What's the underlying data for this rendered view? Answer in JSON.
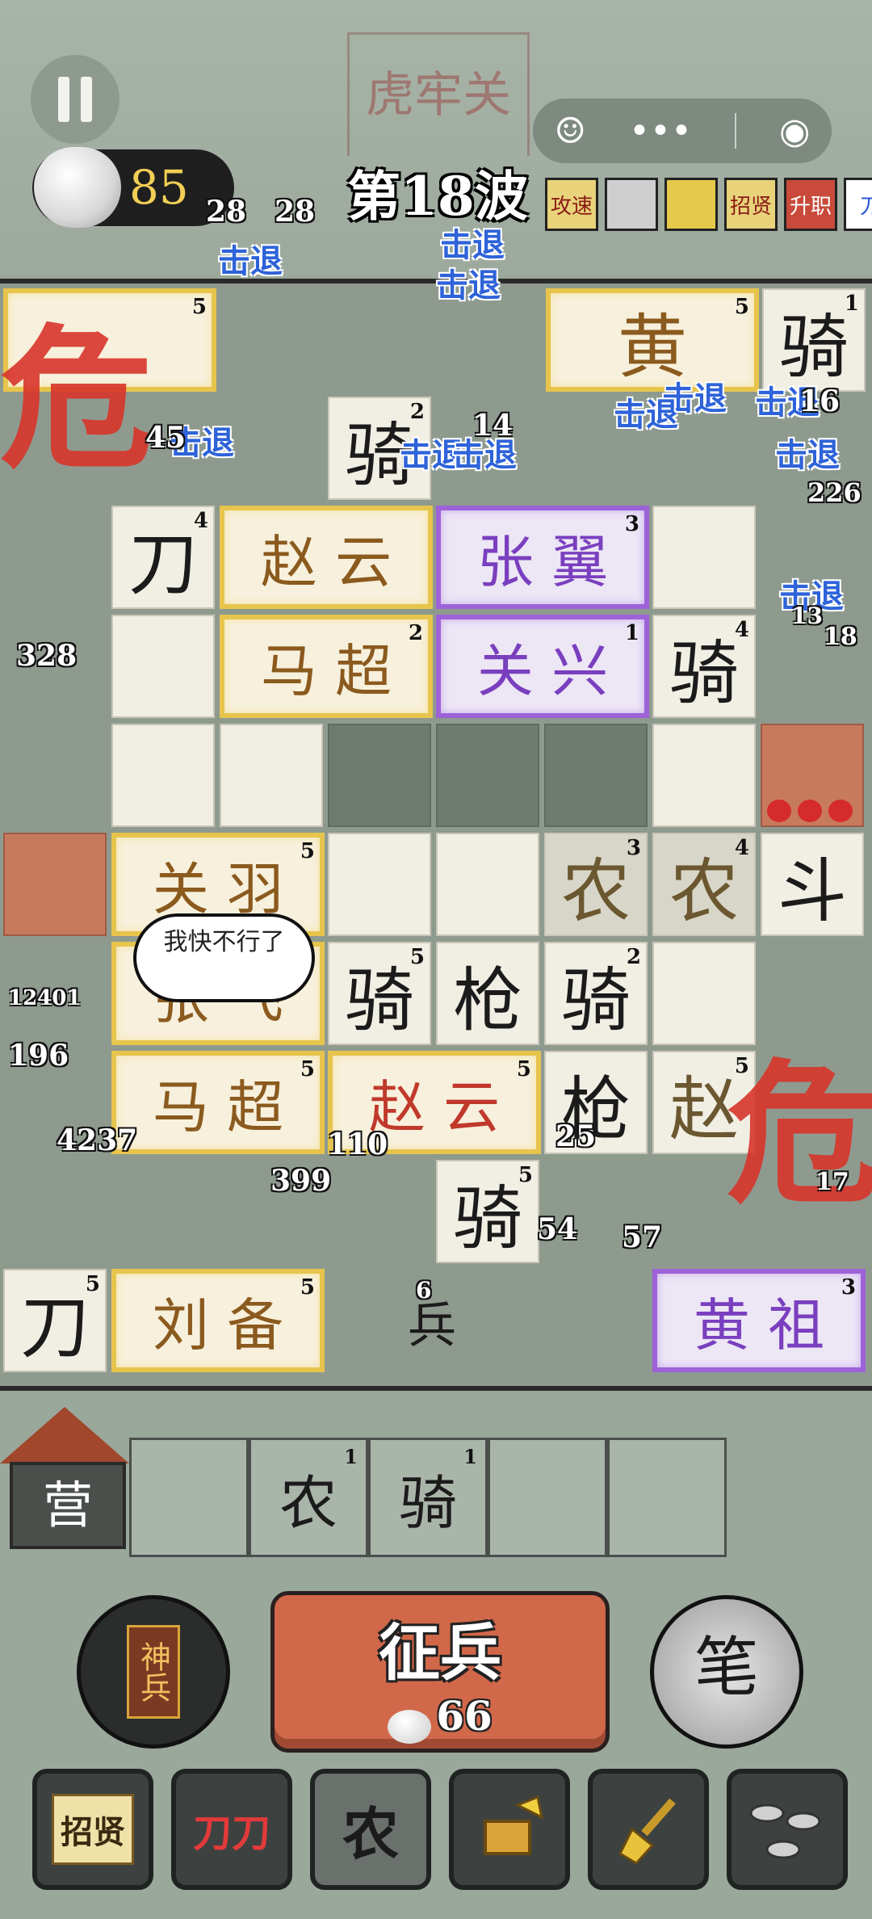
{
  "hud": {
    "resource_count": "85",
    "wave": "第18波",
    "fort_sign": "虎牢关",
    "capsule_more": "•••",
    "capsule_close": "◉",
    "buffs": [
      "攻速",
      "",
      "",
      "招贤",
      "升职",
      "刀"
    ]
  },
  "board": {
    "cells": [
      {
        "glyph": "",
        "level": "5",
        "style": "gold"
      },
      {
        "glyph": "黄",
        "level": "5",
        "style": "gold"
      },
      {
        "glyph": "骑",
        "level": "1",
        "style": "plain"
      },
      {
        "glyph": "骑",
        "level": "2",
        "style": "plain"
      },
      {
        "glyph": "刀",
        "level": "4",
        "style": "plain"
      },
      {
        "glyph": "赵 云",
        "level": "",
        "style": "gold"
      },
      {
        "glyph": "张 翼",
        "level": "3",
        "style": "purple"
      },
      {
        "glyph": "马 超",
        "level": "2",
        "style": "gold"
      },
      {
        "glyph": "关 兴",
        "level": "1",
        "style": "purple"
      },
      {
        "glyph": "骑",
        "level": "4",
        "style": "plain"
      },
      {
        "glyph": "关 羽",
        "level": "5",
        "style": "gold"
      },
      {
        "glyph": "农",
        "level": "3",
        "style": "plain"
      },
      {
        "glyph": "农",
        "level": "4",
        "style": "plain"
      },
      {
        "glyph": "斗",
        "level": "",
        "style": "plain"
      },
      {
        "glyph": "张 飞",
        "level": "5",
        "style": "gold"
      },
      {
        "glyph": "骑",
        "level": "5",
        "style": "plain"
      },
      {
        "glyph": "枪",
        "level": "",
        "style": "plain"
      },
      {
        "glyph": "骑",
        "level": "2",
        "style": "plain"
      },
      {
        "glyph": "马 超",
        "level": "5",
        "style": "gold"
      },
      {
        "glyph": "赵 云",
        "level": "5",
        "style": "gold"
      },
      {
        "glyph": "枪",
        "level": "",
        "style": "plain"
      },
      {
        "glyph": "赵",
        "level": "5",
        "style": "plain"
      },
      {
        "glyph": "骑",
        "level": "5",
        "style": "plain"
      },
      {
        "glyph": "刀",
        "level": "5",
        "style": "plain"
      },
      {
        "glyph": "刘 备",
        "level": "5",
        "style": "gold"
      },
      {
        "glyph": "黄 祖",
        "level": "3",
        "style": "purple"
      },
      {
        "glyph": "兵",
        "level": "",
        "style": "plain"
      }
    ],
    "knockback_label": "击退",
    "danger_glyph": "危",
    "speech_bubble": "我快不行了",
    "numbers": [
      "28",
      "28",
      "45",
      "14",
      "16",
      "328",
      "196",
      "4237",
      "12401",
      "110",
      "399",
      "54",
      "57",
      "25",
      "17",
      "6",
      "226",
      "18",
      "13"
    ]
  },
  "camp": {
    "label": "营",
    "reserve": [
      {
        "glyph": "",
        "level": ""
      },
      {
        "glyph": "农",
        "level": "1"
      },
      {
        "glyph": "骑",
        "level": "1"
      },
      {
        "glyph": "",
        "level": ""
      },
      {
        "glyph": "",
        "level": ""
      }
    ]
  },
  "actions": {
    "shen_bing": "神兵",
    "recruit_title": "征兵",
    "recruit_cost": "66",
    "brush": "笔"
  },
  "toolbar": [
    {
      "label": "招贤",
      "icon": "scroll-icon"
    },
    {
      "label": "刀刀",
      "icon": "blade-icon"
    },
    {
      "label": "农",
      "icon": "farmer-icon"
    },
    {
      "label": "",
      "icon": "treasure-shovel-icon"
    },
    {
      "label": "",
      "icon": "shovel-icon"
    },
    {
      "label": "",
      "icon": "bullets-icon"
    }
  ]
}
